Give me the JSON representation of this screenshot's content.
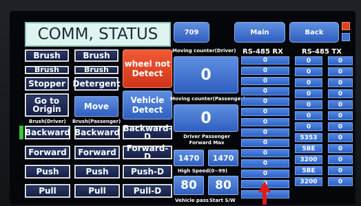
{
  "title": "COMM, STATUS",
  "top": {
    "counter_value": "709",
    "main_label": "Main",
    "back_label": "Back"
  },
  "left": {
    "row1": [
      "Brush",
      "Brush"
    ],
    "row2": [
      "Brush",
      "Brush"
    ],
    "row3": [
      "Stopper",
      "Detergent"
    ],
    "go_origin": "Go to Origin",
    "move": "Move",
    "brush_driver_label": "Brush(Driver)",
    "brush_passenger_label": "Brush(Passenger)",
    "backward": [
      "Backward",
      "Backward",
      "Backward-D"
    ],
    "forward": [
      "Forward",
      "Forward",
      "Forward-D"
    ],
    "push": [
      "Push",
      "Push",
      "Push-D"
    ],
    "pull": [
      "Pull",
      "Pull",
      "Pull-D"
    ]
  },
  "middle": {
    "wheel_not_detect": "wheel not Detect",
    "vehicle_detect": "Vehicle Detect",
    "moving_counter_driver_label": "Moving counter(Driver)",
    "moving_counter_driver_value": "0",
    "moving_counter_passenger_label": "Moving counter(Passenger)",
    "moving_counter_passenger_value": "0",
    "forward_max_label": "Driver Passenger Forward Max",
    "forward_max_driver": "1470",
    "forward_max_passenger": "1470",
    "high_speed_label": "High Speed(0~99)",
    "high_speed_driver": "80",
    "high_speed_passenger": "80",
    "vehicle_pass_label": "Vehicle pass",
    "start_sw_label": "Start S/W"
  },
  "rs485": {
    "rx_label": "RS-485 RX",
    "tx_label": "RS-485 TX",
    "rx": [
      "0",
      "0",
      "0",
      "0",
      "0",
      "0",
      "0",
      "0",
      "0",
      "0",
      "0",
      "0",
      "0",
      "0"
    ],
    "tx_col1": [
      "0",
      "0",
      "0",
      "0",
      "0",
      "0",
      "0",
      "5353",
      "5BE",
      "3200",
      "5BE",
      "3200"
    ],
    "tx_col2": [
      "0",
      "0",
      "0",
      "0",
      "0",
      "0",
      "0",
      "0",
      "0",
      "0",
      "0",
      "0"
    ]
  },
  "colors": {
    "accent_blue": "#3d70d6",
    "alert_red": "#e0411f",
    "indicator_green": "#3ec23a"
  }
}
